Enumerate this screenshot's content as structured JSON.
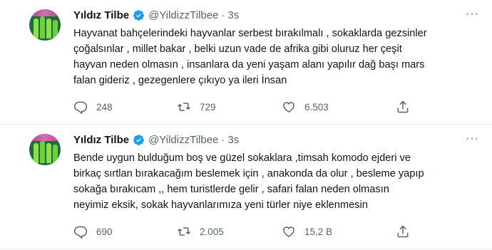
{
  "tweets": [
    {
      "name": "Yıldız Tilbe",
      "handle": "@YildizzTilbee",
      "separator": "·",
      "time": "3s",
      "text": "Hayvanat bahçelerindeki hayvanlar serbest bırakılmalı , sokaklarda gezsinler\nçoğalsınlar , millet bakar , belki uzun vade de afrika gibi oluruz her çeşit\nhayvan neden olmasın , insanlara da yeni yaşam alanı yapılır dağ başı mars\nfalan  gideriz , gezegenlere çıkıyo ya ileri İnsan",
      "replies": "248",
      "retweets": "729",
      "likes": "6.503"
    },
    {
      "name": "Yıldız Tilbe",
      "handle": "@YildizzTilbee",
      "separator": "·",
      "time": "3s",
      "text": "Bende uygun bulduğum boş ve güzel sokaklara ,timsah komodo ejderi ve\nbirkaç sırtlan bırakacağım  beslemek için , anakonda da olur , besleme yapıp\nsokağa bırakıcam ,, hem turistlerde gelir , safari falan neden olmasın\nneyimiz eksik, sokak hayvanlarımıza yeni türler niye eklenmesin",
      "replies": "690",
      "retweets": "2.005",
      "likes": "15,2 B"
    }
  ],
  "icons": {
    "verified": "verified-badge-icon",
    "more": "more-options-icon",
    "reply": "reply-icon",
    "retweet": "retweet-icon",
    "like": "like-icon",
    "share": "share-icon"
  },
  "colors": {
    "verified": "#1d9bf0",
    "muted": "#536471",
    "text": "#0f1419"
  },
  "more_glyph": "···"
}
